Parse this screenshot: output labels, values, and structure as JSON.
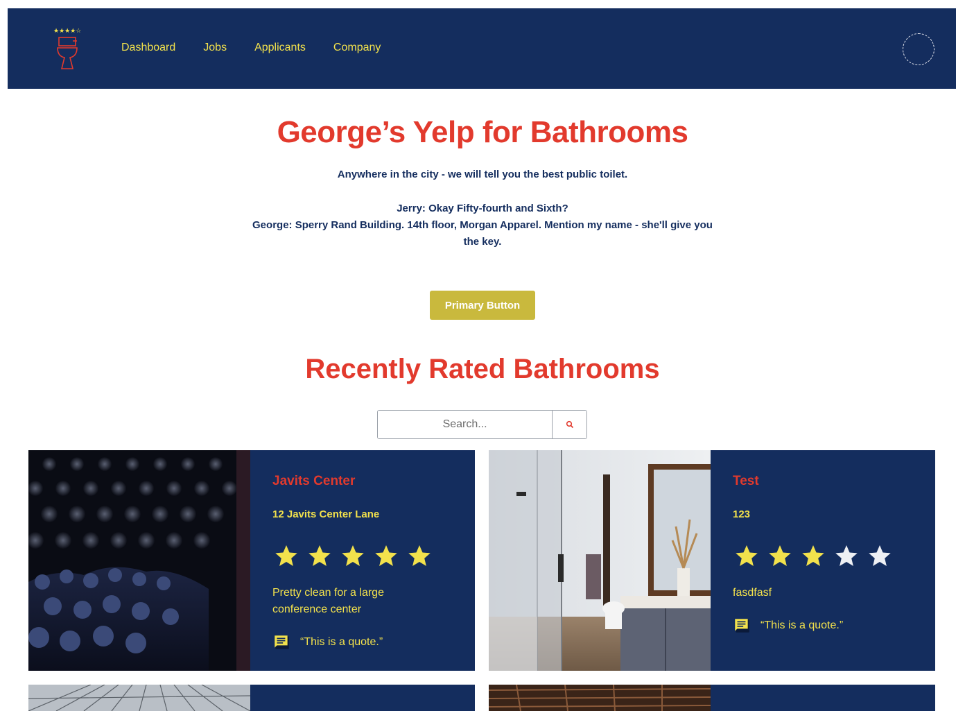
{
  "nav": {
    "links": [
      "Dashboard",
      "Jobs",
      "Applicants",
      "Company"
    ]
  },
  "hero": {
    "title": "George’s Yelp for Bathrooms",
    "subtitle": "Anywhere in the city - we will tell you the best public toilet.",
    "quote_line1": "Jerry: Okay Fifty-fourth and Sixth?",
    "quote_line2": "George: Sperry Rand Building. 14th floor, Morgan Apparel. Mention my name - she'll give you the key.",
    "button_label": "Primary Button"
  },
  "section": {
    "title": "Recently Rated Bathrooms"
  },
  "search": {
    "placeholder": "Search..."
  },
  "cards": [
    {
      "title": "Javits Center",
      "address": "12 Javits Center Lane",
      "rating": 5,
      "description": "Pretty clean for a large conference center",
      "quote": "“This is a quote.”",
      "image_icon": "conference-audience-photo"
    },
    {
      "title": "Test",
      "address": "123",
      "rating": 3,
      "description": "fasdfasf",
      "quote": "“This is a quote.”",
      "image_icon": "bathroom-photo"
    }
  ],
  "colors": {
    "navy": "#142d5e",
    "yellow": "#f2e14c",
    "red": "#e23a2d",
    "button": "#c9b93d"
  }
}
